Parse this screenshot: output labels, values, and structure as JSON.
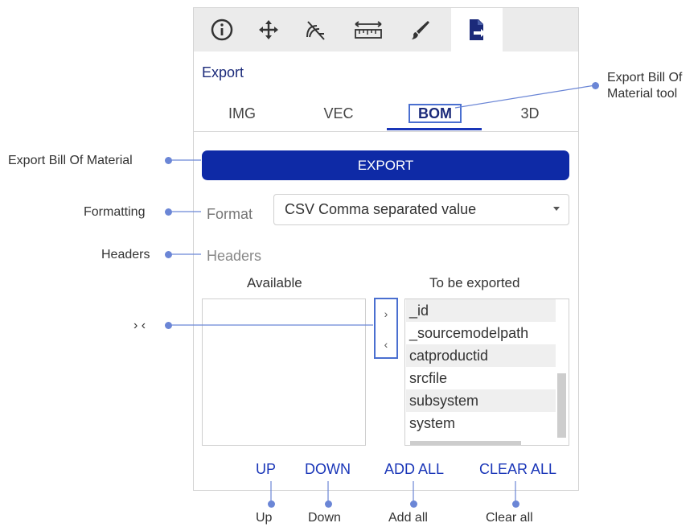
{
  "toolbar": {
    "tools": [
      "info-icon",
      "move-icon",
      "visibility-off-icon",
      "ruler-icon",
      "brush-icon",
      "export-document-icon"
    ]
  },
  "panel": {
    "title": "Export",
    "tabs": [
      {
        "label": "IMG",
        "active": false
      },
      {
        "label": "VEC",
        "active": false
      },
      {
        "label": "BOM",
        "active": true
      },
      {
        "label": "3D",
        "active": false
      }
    ],
    "export_button": "EXPORT",
    "format_label": "Format",
    "format_value": "CSV Comma separated value",
    "headers_label": "Headers",
    "available_title": "Available",
    "exported_title": "To be exported",
    "move_right": "›",
    "move_left": "‹",
    "exported_items": [
      "_id",
      "_sourcemodelpath",
      "catproductid",
      "srcfile",
      "subsystem",
      "system"
    ],
    "actions": {
      "up": "UP",
      "down": "DOWN",
      "add_all": "ADD ALL",
      "clear_all": "CLEAR ALL"
    }
  },
  "annotations": {
    "export_bom_tool": "Export Bill Of\nMaterial tool",
    "export_bom_line1": "Export Bill Of",
    "export_bom_line2": "Material tool",
    "export_bom": "Export Bill Of Material",
    "formatting": "Formatting",
    "headers": "Headers",
    "move_arrows": "›  ‹",
    "up": "Up",
    "down": "Down",
    "add_all": "Add all",
    "clear_all": "Clear all"
  },
  "colors": {
    "accent": "#0e2aa6",
    "link": "#1a36b8",
    "annotation": "#6b86d6"
  }
}
